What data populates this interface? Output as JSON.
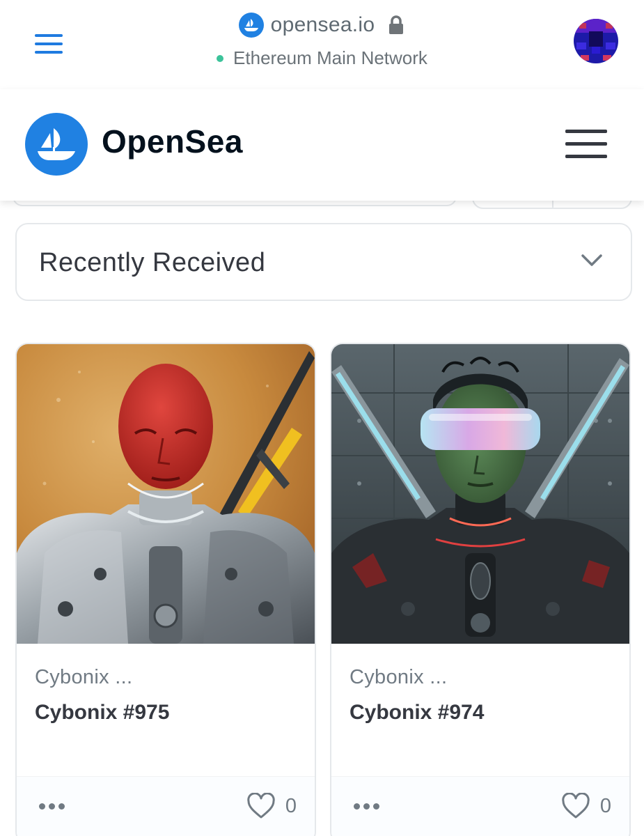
{
  "wallet_bar": {
    "url": "opensea.io",
    "network": "Ethereum Main Network",
    "icons": {
      "menu": "hamburger-menu-icon",
      "site": "opensea-favicon-icon",
      "lock": "lock-icon",
      "account": "account-avatar"
    }
  },
  "header": {
    "brand": "OpenSea",
    "icons": {
      "logo": "opensea-logo-icon",
      "menu": "hamburger-menu-icon"
    }
  },
  "sort": {
    "selected": "Recently Received",
    "icon": "chevron-down-icon"
  },
  "cards": [
    {
      "collection": "Cybonix ...",
      "name": "Cybonix #975",
      "favorites": "0",
      "image_subject": "robot with red humanlike head in silver armor",
      "more_icon": "more-dots-icon",
      "favorite_icon": "heart-icon"
    },
    {
      "collection": "Cybonix ...",
      "name": "Cybonix #974",
      "favorites": "0",
      "image_subject": "robot with green head and glowing visor in dark armor",
      "more_icon": "more-dots-icon",
      "favorite_icon": "heart-icon"
    }
  ],
  "colors": {
    "brand_blue": "#2081e2",
    "network_green": "#3cc39a",
    "text_dark": "#04111d",
    "text_muted": "#707a83",
    "border": "#e5e8eb"
  }
}
